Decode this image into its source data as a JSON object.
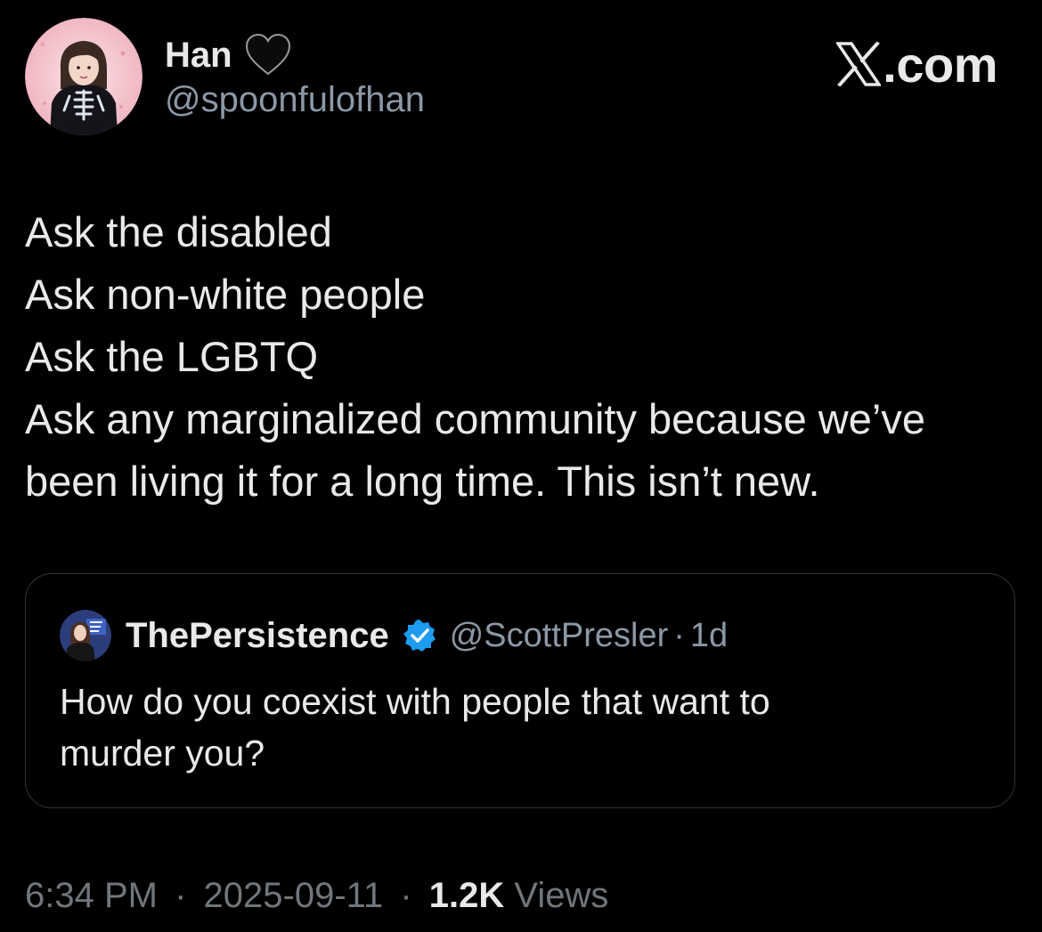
{
  "author": {
    "name": "Han",
    "handle": "@spoonfulofhan",
    "emoji_icon": "black-heart-icon",
    "avatar_icon": "profile-photo"
  },
  "brand": {
    "logo_icon": "x-logo-icon",
    "text": ".com"
  },
  "tweet": {
    "lines": [
      "Ask the disabled",
      "Ask non-white people",
      "Ask the LGBTQ",
      "Ask any marginalized community because we’ve",
      "been living it for a long time. This isn’t new."
    ]
  },
  "quote": {
    "name": "ThePersistence",
    "verified_icon": "verified-badge-icon",
    "handle": "@ScottPresler",
    "separator": "·",
    "time": "1d",
    "text_lines": [
      "How do you coexist with people that want to",
      "murder you?"
    ]
  },
  "footer": {
    "time": "6:34 PM",
    "separator": "·",
    "date": "2025-09-11",
    "views_count": "1.2K",
    "views_label": "Views"
  },
  "colors": {
    "background": "#000000",
    "primary_text": "#e7e9ea",
    "secondary_text": "#8b98a5",
    "border": "#2f3336",
    "verified_blue": "#1d9bf0",
    "avatar_ring": "#f3c1cb"
  }
}
